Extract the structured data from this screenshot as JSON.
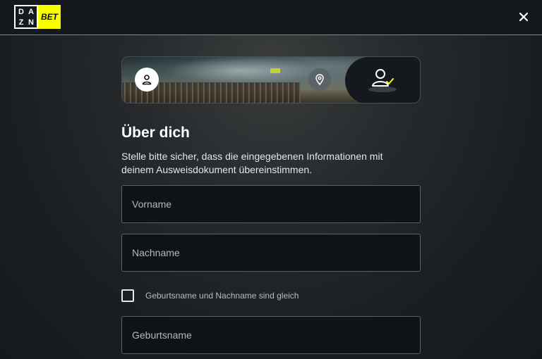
{
  "header": {
    "logo": {
      "dazn_letters": [
        "D",
        "A",
        "Z",
        "N"
      ],
      "bet_text": "BET"
    },
    "close_icon": "close-icon"
  },
  "stepper": {
    "steps": [
      {
        "icon": "person-icon",
        "state": "completed"
      },
      {
        "icon": "location-pin-icon",
        "state": "completed"
      },
      {
        "icon": "person-check-icon",
        "state": "current"
      }
    ]
  },
  "form": {
    "title": "Über dich",
    "subtitle": "Stelle bitte sicher, dass die eingegebenen Informationen mit deinem Ausweisdokument übereinstimmen.",
    "first_name": {
      "placeholder": "Vorname",
      "value": ""
    },
    "last_name": {
      "placeholder": "Nachname",
      "value": ""
    },
    "same_name_checkbox": {
      "label": "Geburtsname und Nachname sind gleich",
      "checked": false
    },
    "birth_name": {
      "placeholder": "Geburtsname",
      "value": ""
    }
  },
  "colors": {
    "accent": "#f7ff00",
    "background": "#15191d",
    "field_border": "#5b6166"
  }
}
